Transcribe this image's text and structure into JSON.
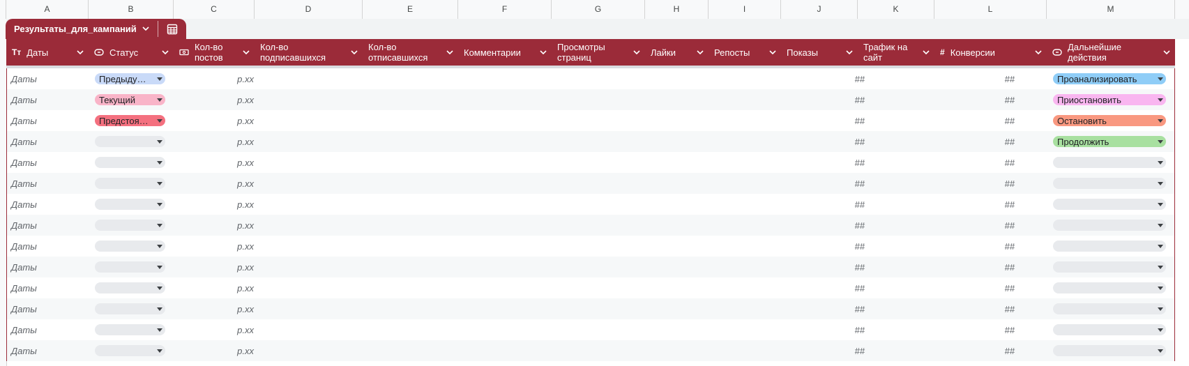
{
  "columns": [
    "A",
    "B",
    "C",
    "D",
    "E",
    "F",
    "G",
    "H",
    "I",
    "J",
    "K",
    "L",
    "M"
  ],
  "table": {
    "name": "Результаты_для_кампаний",
    "accent_color": "#9b2b39"
  },
  "headers": [
    {
      "label": "Даты",
      "icon": "text-type-icon"
    },
    {
      "label": "Статус",
      "icon": "dropdown-chip-icon"
    },
    {
      "label": "Кол-во постов",
      "icon": "currency-icon"
    },
    {
      "label": "Кол-во подписавшихся",
      "icon": ""
    },
    {
      "label": "Кол-во отписавшихся",
      "icon": ""
    },
    {
      "label": "Комментарии",
      "icon": ""
    },
    {
      "label": "Просмотры страниц",
      "icon": ""
    },
    {
      "label": "Лайки",
      "icon": ""
    },
    {
      "label": "Репосты",
      "icon": ""
    },
    {
      "label": "Показы",
      "icon": ""
    },
    {
      "label": "Трафик на сайт",
      "icon": ""
    },
    {
      "label": "Конверсии",
      "icon": "number-icon"
    },
    {
      "label": "Дальнейшие действия",
      "icon": "dropdown-chip-icon"
    }
  ],
  "rows": [
    {
      "date": "Даты",
      "status": "Предыду…",
      "status_color": "#c9daf8",
      "posts": "р.xx",
      "traffic": "##",
      "conversions": "##",
      "action": "Проанализировать",
      "action_color": "#8fcdf7"
    },
    {
      "date": "Даты",
      "status": "Текущий",
      "status_color": "#f9b4c8",
      "posts": "р.xx",
      "traffic": "##",
      "conversions": "##",
      "action": "Приостановить",
      "action_color": "#f9b6f0"
    },
    {
      "date": "Даты",
      "status": "Предстоя…",
      "status_color": "#f4707f",
      "posts": "р.xx",
      "traffic": "##",
      "conversions": "##",
      "action": "Остановить",
      "action_color": "#f99880"
    },
    {
      "date": "Даты",
      "status": "",
      "status_color": "#e8eaed",
      "posts": "р.xx",
      "traffic": "##",
      "conversions": "##",
      "action": "Продолжить",
      "action_color": "#a8e0a0"
    },
    {
      "date": "Даты",
      "status": "",
      "status_color": "#e8eaed",
      "posts": "р.xx",
      "traffic": "##",
      "conversions": "##",
      "action": "",
      "action_color": "#e8eaed"
    },
    {
      "date": "Даты",
      "status": "",
      "status_color": "#e8eaed",
      "posts": "р.xx",
      "traffic": "##",
      "conversions": "##",
      "action": "",
      "action_color": "#e8eaed"
    },
    {
      "date": "Даты",
      "status": "",
      "status_color": "#e8eaed",
      "posts": "р.xx",
      "traffic": "##",
      "conversions": "##",
      "action": "",
      "action_color": "#e8eaed"
    },
    {
      "date": "Даты",
      "status": "",
      "status_color": "#e8eaed",
      "posts": "р.xx",
      "traffic": "##",
      "conversions": "##",
      "action": "",
      "action_color": "#e8eaed"
    },
    {
      "date": "Даты",
      "status": "",
      "status_color": "#e8eaed",
      "posts": "р.xx",
      "traffic": "##",
      "conversions": "##",
      "action": "",
      "action_color": "#e8eaed"
    },
    {
      "date": "Даты",
      "status": "",
      "status_color": "#e8eaed",
      "posts": "р.xx",
      "traffic": "##",
      "conversions": "##",
      "action": "",
      "action_color": "#e8eaed"
    },
    {
      "date": "Даты",
      "status": "",
      "status_color": "#e8eaed",
      "posts": "р.xx",
      "traffic": "##",
      "conversions": "##",
      "action": "",
      "action_color": "#e8eaed"
    },
    {
      "date": "Даты",
      "status": "",
      "status_color": "#e8eaed",
      "posts": "р.xx",
      "traffic": "##",
      "conversions": "##",
      "action": "",
      "action_color": "#e8eaed"
    },
    {
      "date": "Даты",
      "status": "",
      "status_color": "#e8eaed",
      "posts": "р.xx",
      "traffic": "##",
      "conversions": "##",
      "action": "",
      "action_color": "#e8eaed"
    },
    {
      "date": "Даты",
      "status": "",
      "status_color": "#e8eaed",
      "posts": "р.xx",
      "traffic": "##",
      "conversions": "##",
      "action": "",
      "action_color": "#e8eaed"
    }
  ]
}
